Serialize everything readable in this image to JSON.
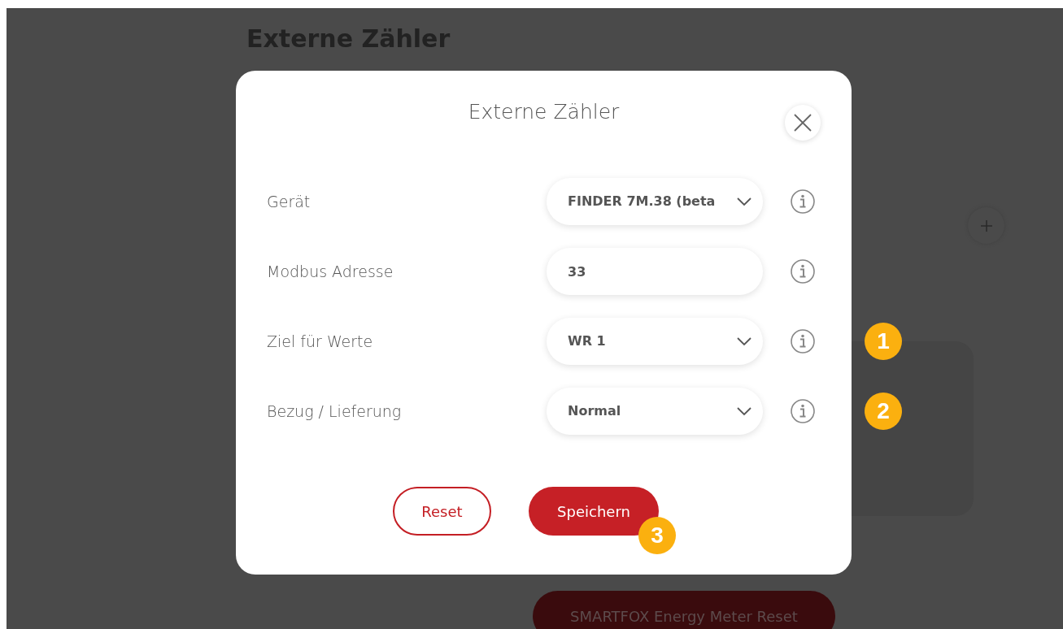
{
  "page": {
    "title": "Externe Zähler",
    "reset_button": "SMARTFOX Energy Meter Reset"
  },
  "dialog": {
    "title": "Externe Zähler",
    "fields": [
      {
        "label": "Gerät",
        "kind": "select",
        "value": "FINDER 7M.38 (beta"
      },
      {
        "label": "Modbus Adresse",
        "kind": "input",
        "value": "33"
      },
      {
        "label": "Ziel für Werte",
        "kind": "select",
        "value": "WR 1",
        "callout": "1"
      },
      {
        "label": "Bezug / Lieferung",
        "kind": "select",
        "value": "Normal",
        "callout": "2"
      }
    ],
    "buttons": [
      {
        "label": "Reset",
        "kind": "outline"
      },
      {
        "label": "Speichern",
        "kind": "primary",
        "callout": "3"
      }
    ]
  }
}
